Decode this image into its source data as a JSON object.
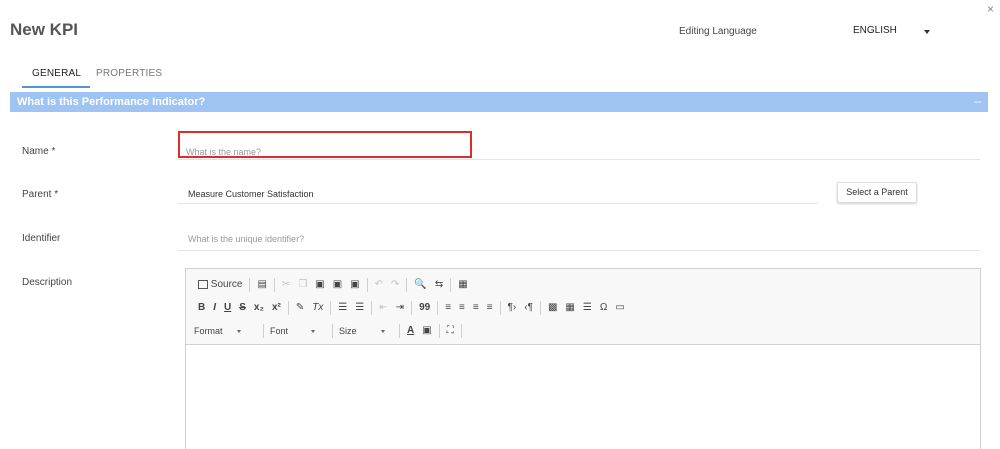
{
  "header": {
    "title": "New KPI",
    "editing_language_label": "Editing Language",
    "language_value": "ENGLISH",
    "close_glyph": "×"
  },
  "tabs": [
    {
      "label": "GENERAL",
      "active": true
    },
    {
      "label": "PROPERTIES",
      "active": false
    }
  ],
  "section": {
    "title": "What is this Performance Indicator?",
    "collapse_glyph": "–",
    "color": "#9fc3f3"
  },
  "form": {
    "name": {
      "label": "Name *",
      "placeholder": "What is the name?",
      "value": ""
    },
    "parent": {
      "label": "Parent *",
      "value": "Measure Customer Satisfaction",
      "button": "Select a Parent"
    },
    "identifier": {
      "label": "Identifier",
      "placeholder": "What is the unique identifier?",
      "value": ""
    },
    "description": {
      "label": "Description"
    }
  },
  "editor_toolbar": {
    "source_label": "Source",
    "format_label": "Format",
    "font_label": "Font",
    "size_label": "Size",
    "bold": "B",
    "italic": "I",
    "underline": "U",
    "strike": "S",
    "subscript": "x₂",
    "superscript": "x²",
    "clear_format": "Tx",
    "blockquote": "99",
    "omega": "Ω",
    "text_color": "A",
    "find": "🔍"
  },
  "colors": {
    "accent": "#4f95d8",
    "highlight_border": "#e02b2b"
  }
}
